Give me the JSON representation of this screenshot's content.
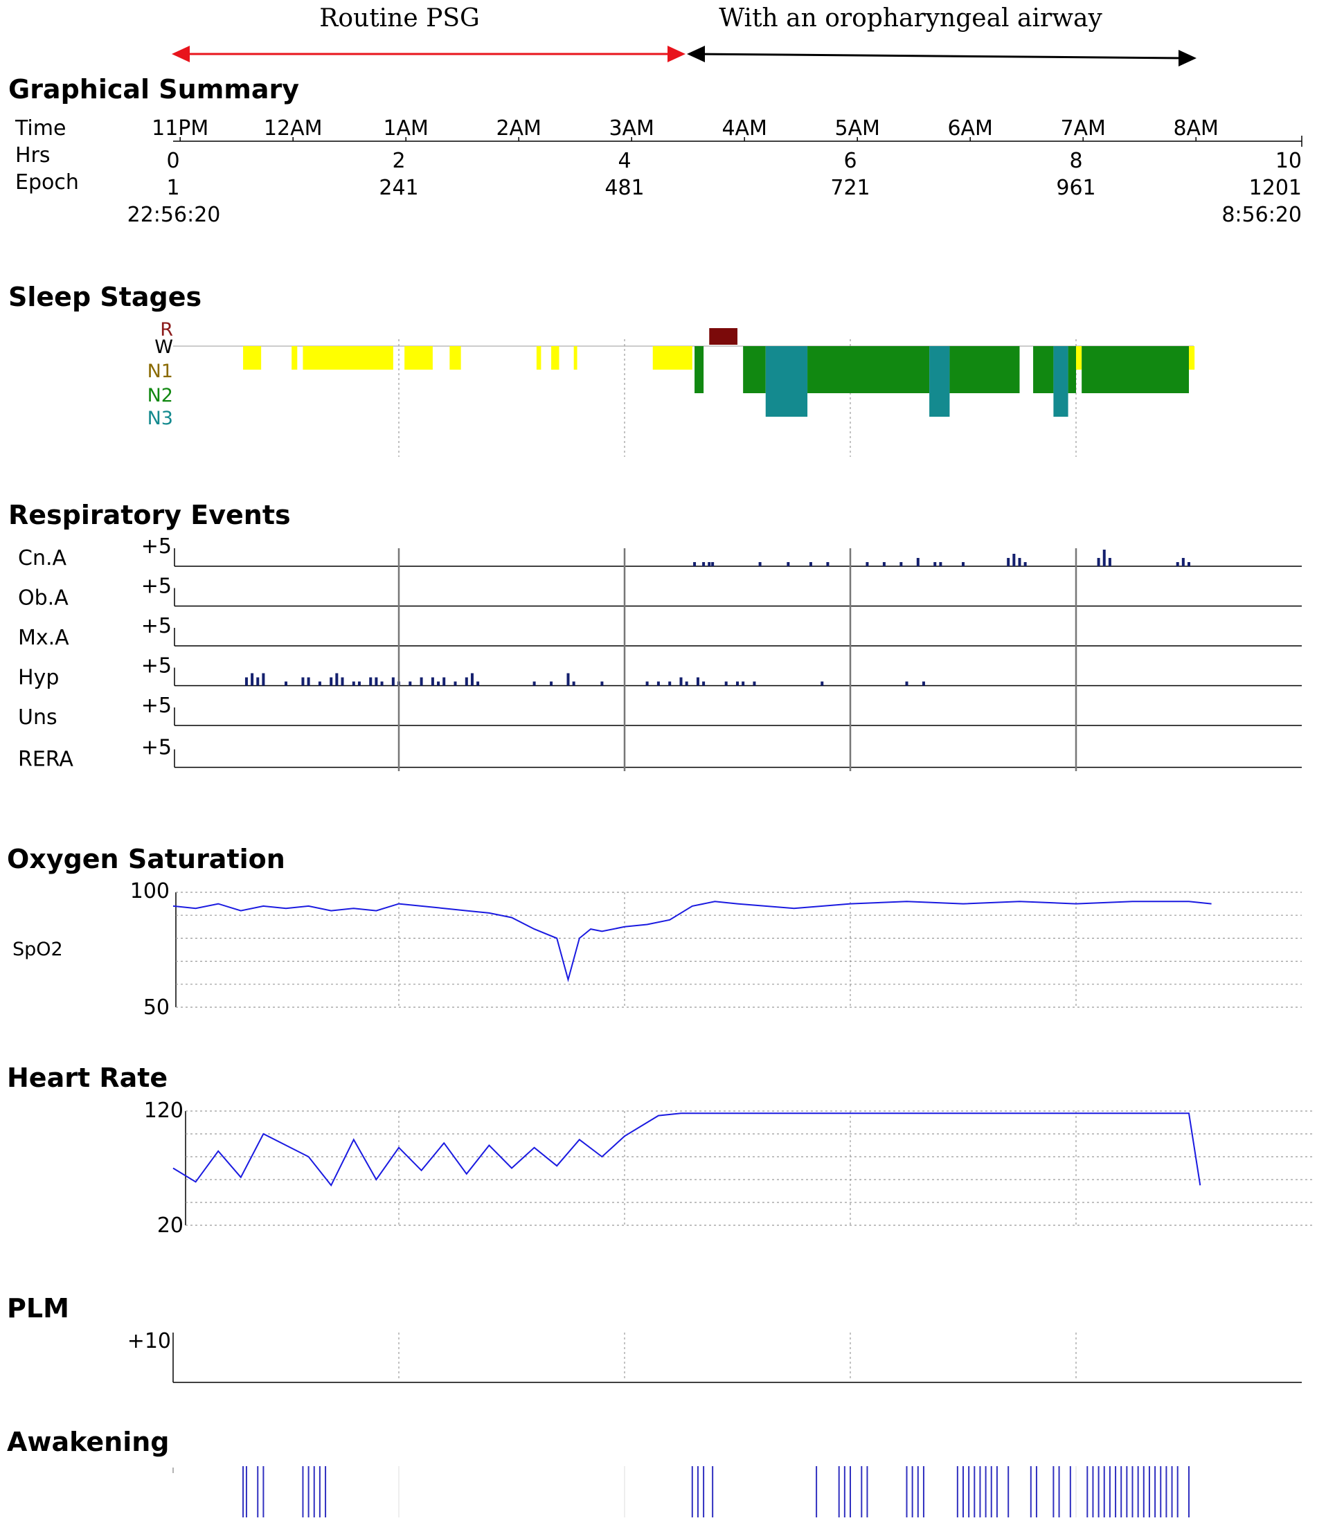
{
  "phases": {
    "routine": "Routine PSG",
    "airway": "With an oropharyngeal airway",
    "routine_color": "#e8141c",
    "airway_color": "#000000"
  },
  "summary": {
    "title": "Graphical Summary",
    "row_labels": [
      "Time",
      "Hrs",
      "Epoch"
    ],
    "time_ticks": [
      "11PM",
      "12AM",
      "1AM",
      "2AM",
      "3AM",
      "4AM",
      "5AM",
      "6AM",
      "7AM",
      "8AM"
    ],
    "hrs_ticks": [
      "0",
      "2",
      "4",
      "6",
      "8",
      "10"
    ],
    "epoch_ticks": [
      "1",
      "241",
      "481",
      "721",
      "961",
      "1201"
    ],
    "start_clock": "22:56:20",
    "end_clock": "8:56:20"
  },
  "sleep": {
    "title": "Sleep Stages",
    "stage_labels": [
      "R",
      "W",
      "N1",
      "N2",
      "N3"
    ],
    "colors": {
      "R": "#7b0a0a",
      "N1": "#ffff00",
      "N2": "#118811",
      "N3": "#148a8f",
      "W": "#888888"
    }
  },
  "resp": {
    "title": "Respiratory Events",
    "rows": [
      "Cn.A",
      "Ob.A",
      "Mx.A",
      "Hyp",
      "Uns",
      "RERA"
    ],
    "scale": "+5",
    "bar_color": "#14206e"
  },
  "spo2": {
    "title": "Oxygen Saturation",
    "label": "SpO2",
    "ymax": "100",
    "ymin": "50",
    "line_color": "#1a1ae0"
  },
  "hr": {
    "title": "Heart Rate",
    "ymax": "120",
    "ymin": "20",
    "line_color": "#1a1ae0"
  },
  "plm": {
    "title": "PLM",
    "scale": "+10"
  },
  "awake": {
    "title": "Awakening",
    "line_color": "#3030c0"
  },
  "chart_data": {
    "type": "line",
    "x_unit": "hours since recording start (22:56:20)",
    "xlim": [
      0,
      10
    ],
    "sleep_stages": {
      "categories": [
        "R",
        "W",
        "N1",
        "N2",
        "N3"
      ],
      "segments": [
        {
          "stage": "N1",
          "start": 0.62,
          "end": 0.78
        },
        {
          "stage": "N1",
          "start": 1.05,
          "end": 1.1
        },
        {
          "stage": "N1",
          "start": 1.15,
          "end": 1.95
        },
        {
          "stage": "N1",
          "start": 2.05,
          "end": 2.3
        },
        {
          "stage": "N1",
          "start": 2.45,
          "end": 2.55
        },
        {
          "stage": "N1",
          "start": 3.22,
          "end": 3.26
        },
        {
          "stage": "N1",
          "start": 3.35,
          "end": 3.42
        },
        {
          "stage": "N1",
          "start": 3.55,
          "end": 3.58
        },
        {
          "stage": "N1",
          "start": 4.25,
          "end": 4.6
        },
        {
          "stage": "N2",
          "start": 4.62,
          "end": 4.7
        },
        {
          "stage": "R",
          "start": 4.75,
          "end": 5.0
        },
        {
          "stage": "N2",
          "start": 5.05,
          "end": 5.25
        },
        {
          "stage": "N3",
          "start": 5.25,
          "end": 5.62
        },
        {
          "stage": "N2",
          "start": 5.62,
          "end": 6.7
        },
        {
          "stage": "N3",
          "start": 6.7,
          "end": 6.88
        },
        {
          "stage": "N2",
          "start": 6.88,
          "end": 7.5
        },
        {
          "stage": "N2",
          "start": 7.62,
          "end": 7.8
        },
        {
          "stage": "N3",
          "start": 7.8,
          "end": 7.93
        },
        {
          "stage": "N2",
          "start": 7.93,
          "end": 8.0
        },
        {
          "stage": "N1",
          "start": 8.0,
          "end": 8.05
        },
        {
          "stage": "N2",
          "start": 8.05,
          "end": 9.0
        },
        {
          "stage": "N1",
          "start": 9.0,
          "end": 9.05
        }
      ]
    },
    "respiratory_events": {
      "ylim": [
        0,
        5
      ],
      "series": [
        {
          "name": "Cn.A",
          "events": [
            [
              4.62,
              1
            ],
            [
              4.7,
              1
            ],
            [
              4.75,
              1
            ],
            [
              4.78,
              1
            ],
            [
              5.2,
              1
            ],
            [
              5.45,
              1
            ],
            [
              5.65,
              1
            ],
            [
              5.8,
              1
            ],
            [
              6.15,
              1
            ],
            [
              6.3,
              1
            ],
            [
              6.45,
              1
            ],
            [
              6.6,
              2
            ],
            [
              6.75,
              1
            ],
            [
              6.8,
              1
            ],
            [
              7.0,
              1
            ],
            [
              7.4,
              2
            ],
            [
              7.45,
              3
            ],
            [
              7.5,
              2
            ],
            [
              7.55,
              1
            ],
            [
              8.2,
              2
            ],
            [
              8.25,
              4
            ],
            [
              8.3,
              2
            ],
            [
              8.9,
              1
            ],
            [
              8.95,
              2
            ],
            [
              9.0,
              1
            ]
          ]
        },
        {
          "name": "Ob.A",
          "events": []
        },
        {
          "name": "Mx.A",
          "events": []
        },
        {
          "name": "Hyp",
          "events": [
            [
              0.65,
              2
            ],
            [
              0.7,
              3
            ],
            [
              0.75,
              2
            ],
            [
              0.8,
              3
            ],
            [
              1.0,
              1
            ],
            [
              1.15,
              2
            ],
            [
              1.2,
              2
            ],
            [
              1.3,
              1
            ],
            [
              1.4,
              2
            ],
            [
              1.45,
              3
            ],
            [
              1.5,
              2
            ],
            [
              1.6,
              1
            ],
            [
              1.65,
              1
            ],
            [
              1.75,
              2
            ],
            [
              1.8,
              2
            ],
            [
              1.85,
              1
            ],
            [
              1.95,
              2
            ],
            [
              2.0,
              1
            ],
            [
              2.1,
              1
            ],
            [
              2.2,
              2
            ],
            [
              2.3,
              2
            ],
            [
              2.35,
              1
            ],
            [
              2.4,
              2
            ],
            [
              2.5,
              1
            ],
            [
              2.6,
              2
            ],
            [
              2.65,
              3
            ],
            [
              2.7,
              1
            ],
            [
              3.2,
              1
            ],
            [
              3.35,
              1
            ],
            [
              3.5,
              3
            ],
            [
              3.55,
              1
            ],
            [
              3.8,
              1
            ],
            [
              4.2,
              1
            ],
            [
              4.3,
              1
            ],
            [
              4.4,
              1
            ],
            [
              4.5,
              2
            ],
            [
              4.55,
              1
            ],
            [
              4.65,
              2
            ],
            [
              4.7,
              1
            ],
            [
              4.9,
              1
            ],
            [
              5.0,
              1
            ],
            [
              5.05,
              1
            ],
            [
              5.15,
              1
            ],
            [
              5.75,
              1
            ],
            [
              6.5,
              1
            ],
            [
              6.65,
              1
            ]
          ]
        },
        {
          "name": "Uns",
          "events": []
        },
        {
          "name": "RERA",
          "events": []
        }
      ]
    },
    "spo2": {
      "ylim": [
        50,
        100
      ],
      "series": [
        {
          "name": "SpO2",
          "x": [
            0,
            0.2,
            0.4,
            0.6,
            0.8,
            1.0,
            1.2,
            1.4,
            1.6,
            1.8,
            2.0,
            2.2,
            2.4,
            2.6,
            2.8,
            3.0,
            3.2,
            3.4,
            3.5,
            3.6,
            3.7,
            3.8,
            4.0,
            4.2,
            4.4,
            4.6,
            4.8,
            5.0,
            5.5,
            6.0,
            6.5,
            7.0,
            7.5,
            8.0,
            8.5,
            9.0,
            9.2
          ],
          "y": [
            94,
            93,
            95,
            92,
            94,
            93,
            94,
            92,
            93,
            92,
            95,
            94,
            93,
            92,
            91,
            89,
            84,
            80,
            62,
            80,
            84,
            83,
            85,
            86,
            88,
            94,
            96,
            95,
            93,
            95,
            96,
            95,
            96,
            95,
            96,
            96,
            95
          ]
        }
      ]
    },
    "heart_rate": {
      "ylim": [
        20,
        120
      ],
      "series": [
        {
          "name": "Heart Rate",
          "x": [
            0,
            0.2,
            0.4,
            0.6,
            0.8,
            1.0,
            1.2,
            1.4,
            1.6,
            1.8,
            2.0,
            2.2,
            2.4,
            2.6,
            2.8,
            3.0,
            3.2,
            3.4,
            3.6,
            3.8,
            4.0,
            4.2,
            4.3,
            4.5,
            4.6,
            5.0,
            5.5,
            6.0,
            6.5,
            7.0,
            7.5,
            8.0,
            8.5,
            9.0,
            9.1
          ],
          "y": [
            70,
            58,
            85,
            62,
            100,
            90,
            80,
            55,
            95,
            60,
            88,
            68,
            92,
            65,
            90,
            70,
            88,
            72,
            95,
            80,
            98,
            110,
            116,
            118,
            118,
            118,
            118,
            118,
            118,
            118,
            118,
            118,
            118,
            118,
            55
          ]
        }
      ]
    },
    "plm": {
      "ylim": [
        0,
        10
      ],
      "events": []
    },
    "awakening": {
      "x": [
        0.62,
        0.65,
        0.75,
        0.8,
        1.15,
        1.2,
        1.25,
        1.3,
        1.35,
        4.6,
        4.65,
        4.7,
        4.78,
        5.7,
        5.9,
        5.95,
        6.0,
        6.1,
        6.15,
        6.5,
        6.55,
        6.6,
        6.65,
        6.95,
        7.0,
        7.05,
        7.1,
        7.15,
        7.2,
        7.25,
        7.3,
        7.4,
        7.6,
        7.65,
        7.8,
        7.85,
        7.95,
        8.1,
        8.15,
        8.2,
        8.25,
        8.3,
        8.35,
        8.4,
        8.45,
        8.5,
        8.55,
        8.6,
        8.65,
        8.7,
        8.75,
        8.8,
        8.85,
        8.9,
        9.0
      ]
    }
  }
}
